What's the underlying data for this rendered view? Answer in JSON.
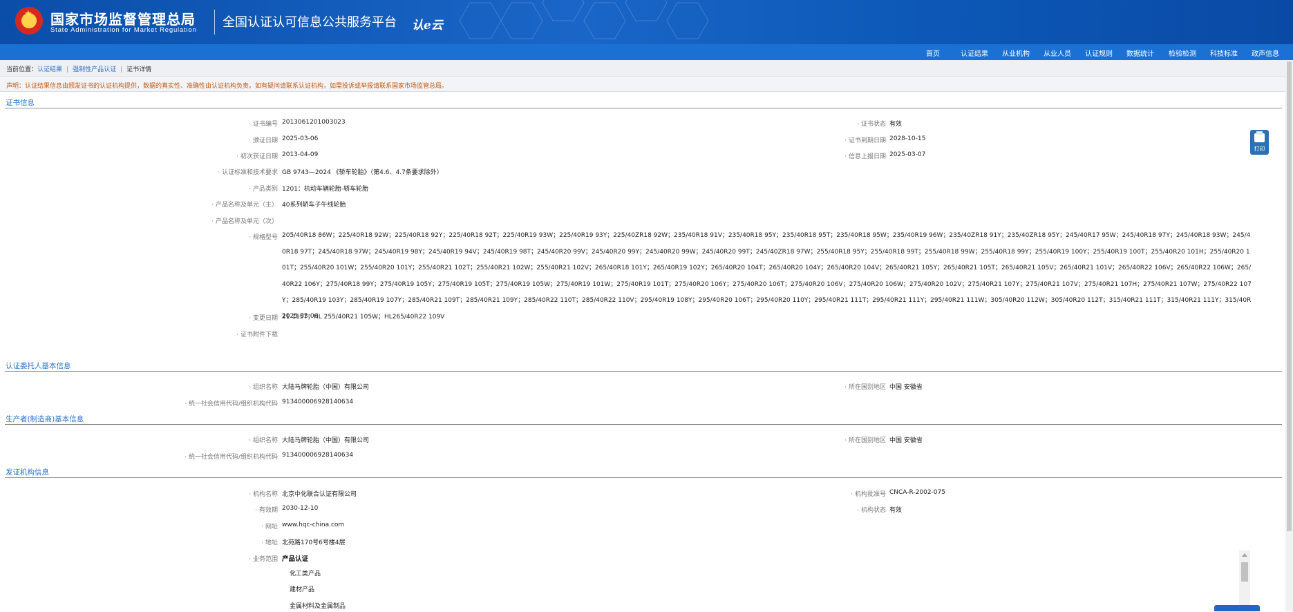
{
  "header": {
    "agency_cn": "国家市场监督管理总局",
    "agency_en": "State Administration  for  Market Regulation",
    "platform_title": "全国认证认可信息公共服务平台",
    "logo_mark": "认e云"
  },
  "nav": {
    "items": [
      "首页",
      "认证结果",
      "从业机构",
      "从业人员",
      "认证规则",
      "数据统计",
      "检验检测",
      "科技标准",
      "政声信息"
    ]
  },
  "breadcrumb": {
    "prefix": "当前位置：",
    "items": [
      "认证结果",
      "强制性产品认证",
      "证书详情"
    ]
  },
  "notice": "声明：认证结果信息由颁发证书的认证机构提供，数据的真实性、准确性由认证机构负责。如有疑问请联系认证机构，如需投诉或举报请联系国家市场监管总局。",
  "cert": {
    "title": "证书信息",
    "cert_no_label": "· 证书编号",
    "cert_no": "2013061201003023",
    "status_label": "· 证书状态",
    "status": "有效",
    "issue_date_label": "· 颁证日期",
    "issue_date": "2025-03-06",
    "expiry_label": "· 证书到期日期",
    "expiry": "2028-10-15",
    "first_date_label": "· 初次获证日期",
    "first_date": "2013-04-09",
    "report_date_label": "· 信息上报日期",
    "report_date": "2025-03-07",
    "standard_label": "· 认证标准和技术要求",
    "standard": "GB 9743—2024 《轿车轮胎》（第4.6、4.7条要求除外）",
    "category_label": "· 产品类别",
    "category": "1201：机动车辆轮胎-轿车轮胎",
    "name_main_label": "· 产品名称及单元（主）",
    "name_main": "40系列轿车子午线轮胎",
    "name_sub_label": "· 产品名称及单元（次）",
    "models_label": "· 规格型号",
    "models": "205/40R18 86W；225/40R18 92W；225/40R18 92Y；225/40R18 92T；225/40R19 93W；225/40R19 93Y；225/40ZR18 92W；235/40R18 91V；235/40R18 95Y；235/40R18 95T；235/40R18 95W；235/40R19 96W；235/40ZR18 91Y；235/40ZR18 95Y；245/40R17 95W；245/40R18 97Y；245/40R18 93W；245/40R18 97T；245/40R18 97W；245/40R19 98Y；245/40R19 94V；245/40R19 98T；245/40R20 99V；245/40R20 99Y；245/40R20 99W；245/40R20 99T；245/40ZR18 97W；255/40R18 95Y；255/40R18 99T；255/40R18 99W；255/40R18 99Y；255/40R19 100Y；255/40R19 100T；255/40R20 101H；255/40R20 101T；255/40R20 101W；255/40R20 101Y；255/40R21 102T；255/40R21 102W；255/40R21 102V；265/40R18 101Y；265/40R19 102Y；265/40R20 104T；265/40R20 104Y；265/40R20 104V；265/40R21 105Y；265/40R21 105T；265/40R21 105V；265/40R21 101V；265/40R22 106V；265/40R22 106W；265/40R22 106Y；275/40R18 99Y；275/40R19 105Y；275/40R19 105T；275/40R19 105W；275/40R19 101W；275/40R19 101T；275/40R20 106Y；275/40R20 106T；275/40R20 106V；275/40R20 106W；275/40R20 102V；275/40R21 107Y；275/40R21 107V；275/40R21 107H；275/40R21 107W；275/40R22 107Y；285/40R19 103Y；285/40R19 107Y；285/40R21 109T；285/40R21 109Y；285/40R22 110T；285/40R22 110V；295/40R19 108Y；295/40R20 106T；295/40R20 110Y；295/40R21 111T；295/40R21 111Y；295/40R21 111W；305/40R20 112W；305/40R20 112T；315/40R21 111T；315/40R21 111Y；315/40R21 115T；HL 255/40R21 105W；HL265/40R22 109V",
    "change_date_label": "· 变更日期",
    "change_date": "2025-03-06",
    "attachment_label": "· 证书附件下载",
    "print_label": "打印"
  },
  "applicant": {
    "title": "认证委托人基本信息",
    "org_label": "· 组织名称",
    "org": "大陆马牌轮胎（中国）有限公司",
    "region_label": "· 所在国别地区",
    "region": "中国 安徽省",
    "code_label": "· 统一社会信用代码/组织机构代码",
    "code": "913400006928140634"
  },
  "manufacturer": {
    "title": "生产者(制造商)基本信息",
    "org_label": "· 组织名称",
    "org": "大陆马牌轮胎（中国）有限公司",
    "region_label": "· 所在国别地区",
    "region": "中国 安徽省",
    "code_label": "· 统一社会信用代码/组织机构代码",
    "code": "913400006928140634"
  },
  "issuer": {
    "title": "发证机构信息",
    "name_label": "· 机构名称",
    "name": "北京中化联合认证有限公司",
    "approval_label": "· 机构批准号",
    "approval": "CNCA-R-2002-075",
    "valid_label": "· 有效期",
    "valid": "2030-12-10",
    "status_label": "· 机构状态",
    "status": "有效",
    "website_label": "· 网址",
    "website": "www.hqc-china.com",
    "address_label": "· 地址",
    "address": "北苑路170号6号楼4层",
    "scope_label": "· 业务范围",
    "scope_head": "产品认证",
    "scope_items": [
      "化工类产品",
      "建材产品",
      "金属材料及金属制品"
    ]
  }
}
